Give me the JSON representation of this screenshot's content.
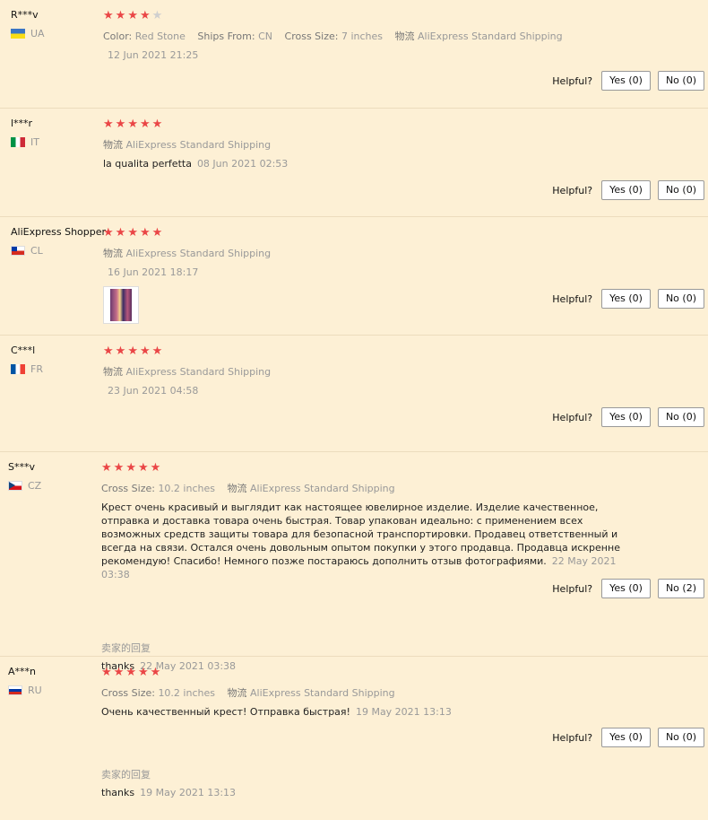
{
  "reviews": [
    {
      "user": "R***v",
      "country": "UA",
      "flag": [
        "#3a75c4",
        "#f9dd16"
      ],
      "stars": 4,
      "attrs": [
        {
          "k": "Color:",
          "v": "Red Stone"
        },
        {
          "k": "Ships From:",
          "v": "CN"
        },
        {
          "k": "Cross Size:",
          "v": "7 inches"
        },
        {
          "k": "物流",
          "v": "AliExpress Standard Shipping"
        }
      ],
      "date": "12 Jun 2021 21:25",
      "yes": "Yes (0)",
      "no": "No (0)"
    },
    {
      "user": "l***r",
      "country": "IT",
      "flag": [
        "#009246",
        "#ffffff",
        "#ce2b37"
      ],
      "stars": 5,
      "attrs": [
        {
          "k": "物流",
          "v": "AliExpress Standard Shipping"
        }
      ],
      "text": "la qualita perfetta",
      "date": "08 Jun 2021 02:53",
      "yes": "Yes (0)",
      "no": "No (0)"
    },
    {
      "user": "AliExpress Shopper",
      "country": "CL",
      "flag": [
        "#ffffff",
        "#d52b1e"
      ],
      "stars": 5,
      "attrs": [
        {
          "k": "物流",
          "v": "AliExpress Standard Shipping"
        }
      ],
      "date": "16 Jun 2021 18:17",
      "yes": "Yes (0)",
      "no": "No (0)"
    },
    {
      "user": "C***l",
      "country": "FR",
      "flag": [
        "#0055a4",
        "#ffffff",
        "#ef4135"
      ],
      "stars": 5,
      "attrs": [
        {
          "k": "物流",
          "v": "AliExpress Standard Shipping"
        }
      ],
      "date": "23 Jun 2021 04:58",
      "yes": "Yes (0)",
      "no": "No (0)"
    },
    {
      "user": "S***v",
      "country": "CZ",
      "flag": [
        "#ffffff",
        "#d7141a",
        "#11457e"
      ],
      "stars": 5,
      "attrs": [
        {
          "k": "Cross Size:",
          "v": "10.2 inches"
        },
        {
          "k": "物流",
          "v": "AliExpress Standard Shipping"
        }
      ],
      "text": "Крест очень красивый и выглядит как настоящее ювелирное изделие. Изделие качественное, отправка и доставка товара очень быстрая. Товар упакован идеально: с применением всех возможных средств защиты товара для безопасной транспортировки. Продавец ответственный и всегда на связи. Остался очень довольным опытом покупки у этого продавца. Продавца искренне рекомендую! Спасибо! Немного позже постараюсь дополнить отзыв фотографиями.",
      "date": "22 May 2021 03:38",
      "yes": "Yes (0)",
      "no": "No (2)",
      "reply_title": "卖家的回复",
      "reply": "thanks",
      "reply_date": "22 May 2021 03:38"
    },
    {
      "user": "A***n",
      "country": "RU",
      "flag": [
        "#ffffff",
        "#0039a6",
        "#d52b1e"
      ],
      "stars": 5,
      "attrs": [
        {
          "k": "Cross Size:",
          "v": "10.2 inches"
        },
        {
          "k": "物流",
          "v": "AliExpress Standard Shipping"
        }
      ],
      "text": "Очень качественный крест! Отправка быстрая!",
      "date": "19 May 2021 13:13",
      "yes": "Yes (0)",
      "no": "No (0)",
      "reply_title": "卖家的回复",
      "reply": "thanks",
      "reply_date": "19 May 2021 13:13"
    }
  ],
  "helpful_label": "Helpful?"
}
